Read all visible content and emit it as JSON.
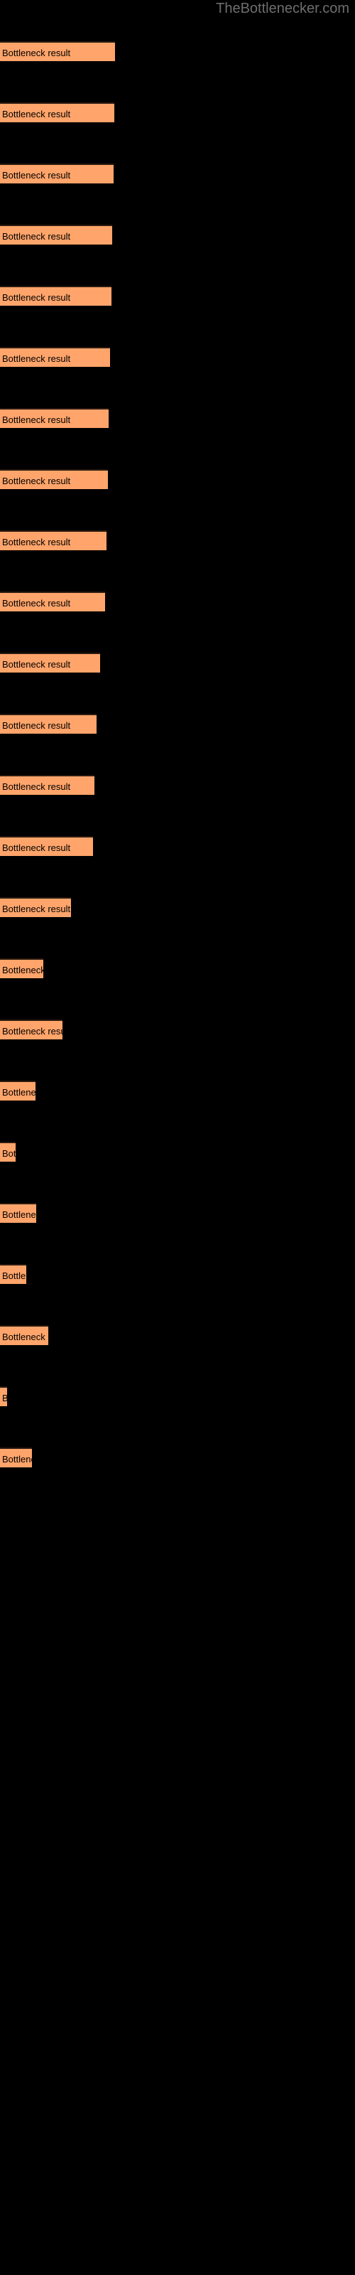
{
  "page": {
    "watermark": "TheBottlenecker.com",
    "background_color": "#000000",
    "bar_color": "#ffa46a",
    "bar_border_color": "#2a1a10",
    "label_color": "#000000",
    "watermark_color": "#6e6e6e"
  },
  "chart_data": {
    "type": "bar",
    "orientation": "horizontal",
    "title": "",
    "subtitle": "",
    "xlabel": "",
    "ylabel": "",
    "grid": false,
    "legend": null,
    "bar_label_text": "Bottleneck result",
    "axis_visible": false,
    "tick_labels": [],
    "xlim": [
      0,
      500
    ],
    "categories": [
      "Bottleneck result",
      "Bottleneck result",
      "Bottleneck result",
      "Bottleneck result",
      "Bottleneck result",
      "Bottleneck result",
      "Bottleneck result",
      "Bottleneck result",
      "Bottleneck result",
      "Bottleneck result",
      "Bottleneck result",
      "Bottleneck result",
      "Bottleneck result",
      "Bottleneck result",
      "Bottleneck result",
      "Bottleneck result",
      "Bottleneck result",
      "Bottleneck result",
      "Bottleneck result",
      "Bottleneck result",
      "Bottleneck result",
      "Bottleneck result",
      "Bottleneck result",
      "Bottleneck result"
    ],
    "values": [
      162,
      161,
      160,
      158,
      157,
      155,
      153,
      152,
      150,
      148,
      141,
      136,
      133,
      131,
      100,
      61,
      88,
      50,
      22,
      51,
      37,
      68,
      10,
      45
    ],
    "bars": [
      {
        "label": "Bottleneck result",
        "value": 162,
        "y": 58
      },
      {
        "label": "Bottleneck result",
        "value": 161,
        "y": 144
      },
      {
        "label": "Bottleneck result",
        "value": 160,
        "y": 230
      },
      {
        "label": "Bottleneck result",
        "value": 158,
        "y": 316
      },
      {
        "label": "Bottleneck result",
        "value": 157,
        "y": 402
      },
      {
        "label": "Bottleneck result",
        "value": 155,
        "y": 488
      },
      {
        "label": "Bottleneck result",
        "value": 153,
        "y": 574
      },
      {
        "label": "Bottleneck result",
        "value": 152,
        "y": 660
      },
      {
        "label": "Bottleneck result",
        "value": 150,
        "y": 746
      },
      {
        "label": "Bottleneck result",
        "value": 148,
        "y": 832
      },
      {
        "label": "Bottleneck result",
        "value": 141,
        "y": 918
      },
      {
        "label": "Bottleneck result",
        "value": 136,
        "y": 1004
      },
      {
        "label": "Bottleneck result",
        "value": 133,
        "y": 1090
      },
      {
        "label": "Bottleneck result",
        "value": 131,
        "y": 1176
      },
      {
        "label": "Bottleneck result",
        "value": 100,
        "y": 1262
      },
      {
        "label": "Bottleneck result",
        "value": 61,
        "y": 1348
      },
      {
        "label": "Bottleneck result",
        "value": 88,
        "y": 1434
      },
      {
        "label": "Bottleneck result",
        "value": 50,
        "y": 1520
      },
      {
        "label": "Bottleneck result",
        "value": 22,
        "y": 1606
      },
      {
        "label": "Bottleneck result",
        "value": 51,
        "y": 1692
      },
      {
        "label": "Bottleneck result",
        "value": 37,
        "y": 1778
      },
      {
        "label": "Bottleneck result",
        "value": 68,
        "y": 1864
      },
      {
        "label": "Bottleneck result",
        "value": 10,
        "y": 1950
      },
      {
        "label": "Bottleneck result",
        "value": 45,
        "y": 2036
      }
    ]
  }
}
